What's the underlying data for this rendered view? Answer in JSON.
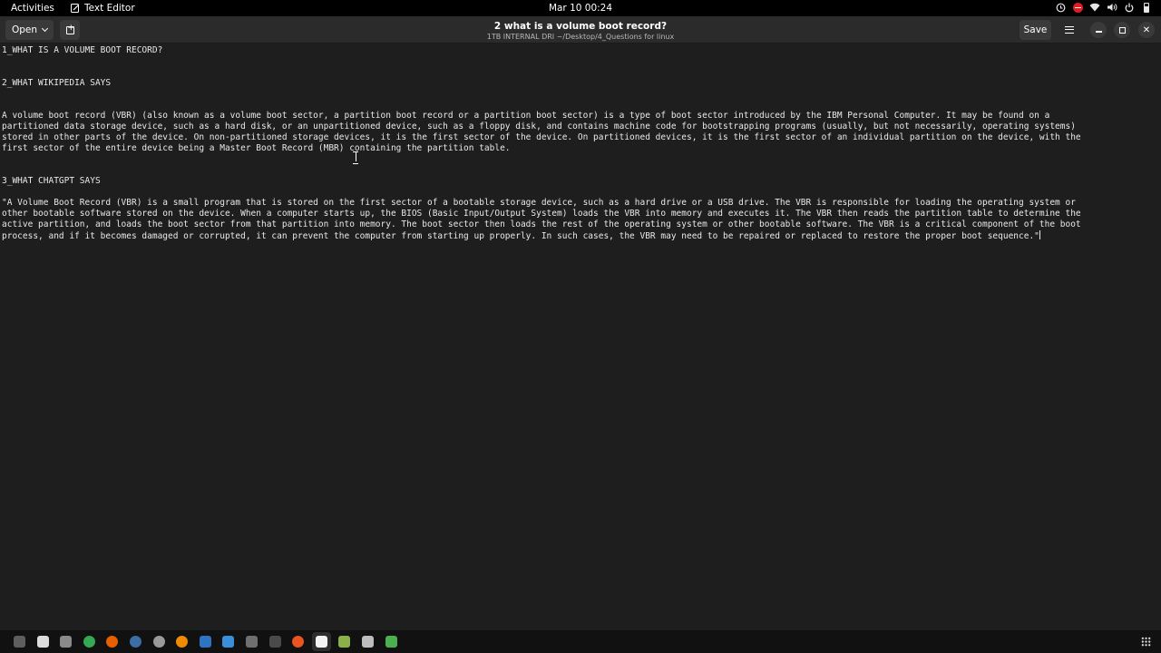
{
  "topbar": {
    "activities": "Activities",
    "app_name": "Text Editor",
    "clock": "Mar 10  00:24"
  },
  "header": {
    "open_label": "Open",
    "title": "2 what is a volume boot record?",
    "subtitle": "1TB INTERNAL DRI ~/Desktop/4_Questions for linux",
    "save_label": "Save"
  },
  "document": {
    "lines": [
      "1_WHAT IS A VOLUME BOOT RECORD?",
      "2_WHAT WIKIPEDIA SAYS",
      "A volume boot record (VBR) (also known as a volume boot sector, a partition boot record or a partition boot sector) is a type of boot sector introduced by the IBM Personal Computer. It may be found on a",
      "partitioned data storage device, such as a hard disk, or an unpartitioned device, such as a floppy disk, and contains machine code for bootstrapping programs (usually, but not necessarily, operating systems)",
      "stored in other parts of the device. On non-partitioned storage devices, it is the first sector of the device. On partitioned devices, it is the first sector of an individual partition on the device, with the",
      "first sector of the entire device being a Master Boot Record (MBR) containing the partition table.",
      "3_WHAT CHATGPT SAYS",
      "\"A Volume Boot Record (VBR) is a small program that is stored on the first sector of a bootable storage device, such as a hard drive or a USB drive. The VBR is responsible for loading the operating system or",
      "other bootable software stored on the device. When a computer starts up, the BIOS (Basic Input/Output System) loads the VBR into memory and executes it. The VBR then reads the partition table to determine the",
      "active partition, and loads the boot sector from that partition into memory. The boot sector then loads the rest of the operating system or other bootable software. The VBR is a critical component of the boot",
      "process, and if it becomes damaged or corrupted, it can prevent the computer from starting up properly. In such cases, the VBR may need to be repaired or replaced to restore the proper boot sequence.\""
    ]
  },
  "taskbar": {
    "apps": [
      {
        "name": "files-icon",
        "color": "#5e5e5e"
      },
      {
        "name": "text-editor-icon",
        "color": "#dcdcdc"
      },
      {
        "name": "folder-icon",
        "color": "#8a8a8a"
      },
      {
        "name": "chrome-icon",
        "color": "#34a853"
      },
      {
        "name": "firefox-icon",
        "color": "#e66000"
      },
      {
        "name": "steam-icon",
        "color": "#3b6ea5"
      },
      {
        "name": "settings-icon",
        "color": "#9a9a9a"
      },
      {
        "name": "vlc-icon",
        "color": "#f08a00"
      },
      {
        "name": "virtualbox-icon",
        "color": "#2f74c0"
      },
      {
        "name": "vscode-icon",
        "color": "#3a8fd8"
      },
      {
        "name": "terminal-icon",
        "color": "#6f6f6f"
      },
      {
        "name": "calculator-icon",
        "color": "#4a4a4a"
      },
      {
        "name": "app-icon-orange",
        "color": "#e95420"
      },
      {
        "name": "text-editor-active-icon",
        "color": "#f2f2f2"
      },
      {
        "name": "notes-icon",
        "color": "#8bb04a"
      },
      {
        "name": "document-icon",
        "color": "#bdbdbd"
      },
      {
        "name": "spreadsheet-icon",
        "color": "#4caf50"
      }
    ]
  }
}
